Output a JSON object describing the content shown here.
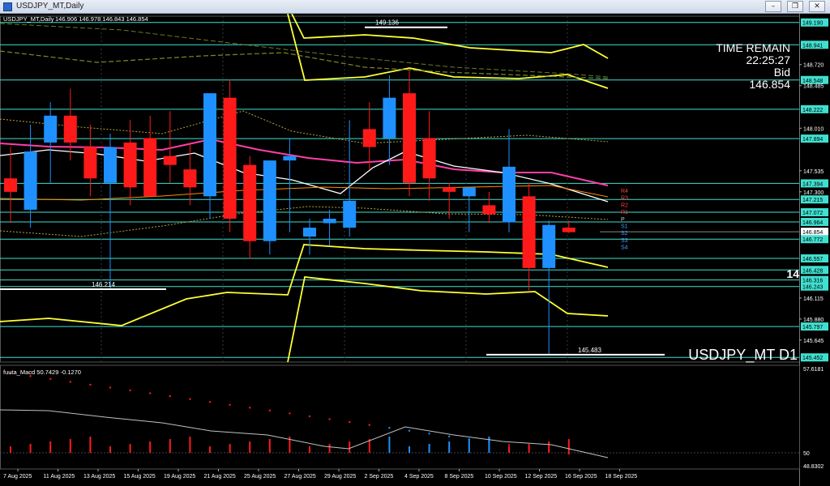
{
  "window": {
    "title": "USDJPY_MT,Daily",
    "buttons": {
      "minimize": "–",
      "restore": "❐",
      "close": "✕"
    }
  },
  "colors": {
    "background": "#000000",
    "bull": "#1e90ff",
    "bear": "#ff1a1a",
    "level_line": "#40e0d0",
    "band": "#ffff33",
    "macd_line": "#c0c0c0"
  },
  "chart_data": {
    "type": "candlestick",
    "symbol_label": "USDJPY_MT,Daily",
    "ohlc_header": "146.906 146.978 146.843 146.854",
    "watermark": "USDJPY_MT D1",
    "info_panel": [
      "TIME REMAIN",
      "22:25:27",
      "Bid",
      "146.854"
    ],
    "ylim": [
      145.4,
      149.26
    ],
    "dates": [
      "7 Aug 2025",
      "11 Aug 2025",
      "13 Aug 2025",
      "15 Aug 2025",
      "19 Aug 2025",
      "21 Aug 2025",
      "25 Aug 2025",
      "27 Aug 2025",
      "29 Aug 2025",
      "2 Sep 2025",
      "4 Sep 2025",
      "8 Sep 2025",
      "10 Sep 2025",
      "12 Sep 2025",
      "16 Sep 2025",
      "18 Sep 2025"
    ],
    "candles": [
      {
        "o": 147.45,
        "h": 147.8,
        "l": 146.95,
        "c": 147.3
      },
      {
        "o": 147.1,
        "h": 148.05,
        "l": 146.9,
        "c": 147.75
      },
      {
        "o": 147.85,
        "h": 148.3,
        "l": 147.4,
        "c": 148.15
      },
      {
        "o": 148.15,
        "h": 148.45,
        "l": 147.65,
        "c": 147.85
      },
      {
        "o": 147.8,
        "h": 148.05,
        "l": 147.25,
        "c": 147.45
      },
      {
        "o": 147.4,
        "h": 147.95,
        "l": 146.21,
        "c": 147.8
      },
      {
        "o": 147.85,
        "h": 148.1,
        "l": 147.15,
        "c": 147.35
      },
      {
        "o": 147.9,
        "h": 148.15,
        "l": 147.3,
        "c": 147.25
      },
      {
        "o": 147.7,
        "h": 148.2,
        "l": 147.4,
        "c": 147.6
      },
      {
        "o": 147.55,
        "h": 147.85,
        "l": 147.15,
        "c": 147.35
      },
      {
        "o": 147.25,
        "h": 148.4,
        "l": 147.0,
        "c": 148.4
      },
      {
        "o": 148.35,
        "h": 148.55,
        "l": 146.85,
        "c": 147.0
      },
      {
        "o": 147.6,
        "h": 147.7,
        "l": 146.55,
        "c": 146.75
      },
      {
        "o": 146.75,
        "h": 147.6,
        "l": 146.6,
        "c": 147.65
      },
      {
        "o": 147.65,
        "h": 147.9,
        "l": 146.85,
        "c": 147.7
      },
      {
        "o": 146.8,
        "h": 147.0,
        "l": 146.6,
        "c": 146.9
      },
      {
        "o": 146.95,
        "h": 147.1,
        "l": 146.7,
        "c": 147.0
      },
      {
        "o": 146.9,
        "h": 148.1,
        "l": 146.8,
        "c": 147.2
      },
      {
        "o": 148.0,
        "h": 148.3,
        "l": 147.55,
        "c": 147.8
      },
      {
        "o": 147.9,
        "h": 148.6,
        "l": 147.6,
        "c": 148.35
      },
      {
        "o": 148.4,
        "h": 148.65,
        "l": 147.25,
        "c": 147.4
      },
      {
        "o": 147.9,
        "h": 148.2,
        "l": 147.2,
        "c": 147.45
      },
      {
        "o": 147.35,
        "h": 147.4,
        "l": 147.0,
        "c": 147.3
      },
      {
        "o": 147.25,
        "h": 147.3,
        "l": 146.85,
        "c": 147.35
      },
      {
        "o": 147.15,
        "h": 147.3,
        "l": 146.95,
        "c": 147.05
      },
      {
        "o": 146.96,
        "h": 148.0,
        "l": 146.85,
        "c": 147.58
      },
      {
        "o": 147.25,
        "h": 147.4,
        "l": 146.2,
        "c": 146.45
      },
      {
        "o": 146.45,
        "h": 146.98,
        "l": 145.48,
        "c": 146.93
      },
      {
        "o": 146.9,
        "h": 146.98,
        "l": 146.84,
        "c": 146.85
      }
    ],
    "price_levels": [
      {
        "label": "149.190",
        "value": 149.19
      },
      {
        "label": "148.941",
        "value": 148.941
      },
      {
        "label": "148.548",
        "value": 148.548
      },
      {
        "label": "148.222",
        "value": 148.222
      },
      {
        "label": "147.894",
        "value": 147.894
      },
      {
        "label": "147.394",
        "value": 147.394
      },
      {
        "label": "147.215",
        "value": 147.215
      },
      {
        "label": "147.072",
        "value": 147.072
      },
      {
        "label": "146.964",
        "value": 146.964
      },
      {
        "label": "146.772",
        "value": 146.772
      },
      {
        "label": "146.557",
        "value": 146.557
      },
      {
        "label": "146.428",
        "value": 146.428
      },
      {
        "label": "146.316",
        "value": 146.316
      },
      {
        "label": "146.243",
        "value": 146.243
      },
      {
        "label": "145.797",
        "value": 145.797
      },
      {
        "label": "145.452",
        "value": 145.452
      }
    ],
    "axis_ticks": [
      {
        "label": "149.190",
        "value": 149.19,
        "hl": true
      },
      {
        "label": "148.941",
        "value": 148.941,
        "hl": true
      },
      {
        "label": "148.720",
        "value": 148.72,
        "hl": false
      },
      {
        "label": "148.548",
        "value": 148.548,
        "hl": true
      },
      {
        "label": "148.485",
        "value": 148.485,
        "hl": false
      },
      {
        "label": "148.222",
        "value": 148.222,
        "hl": true
      },
      {
        "label": "148.010",
        "value": 148.01,
        "hl": false
      },
      {
        "label": "147.894",
        "value": 147.894,
        "hl": true
      },
      {
        "label": "147.535",
        "value": 147.535,
        "hl": false
      },
      {
        "label": "147.394",
        "value": 147.394,
        "hl": true
      },
      {
        "label": "147.300",
        "value": 147.3,
        "hl": false
      },
      {
        "label": "147.215",
        "value": 147.215,
        "hl": true
      },
      {
        "label": "147.072",
        "value": 147.072,
        "hl": true
      },
      {
        "label": "146.964",
        "value": 146.964,
        "hl": true
      },
      {
        "label": "146.854",
        "value": 146.854,
        "hl": "bid"
      },
      {
        "label": "146.772",
        "value": 146.772,
        "hl": true
      },
      {
        "label": "146.557",
        "value": 146.557,
        "hl": true
      },
      {
        "label": "146.428",
        "value": 146.428,
        "hl": true
      },
      {
        "label": "146.316",
        "value": 146.316,
        "hl": true
      },
      {
        "label": "146.243",
        "value": 146.243,
        "hl": true
      },
      {
        "label": "146.115",
        "value": 146.115,
        "hl": false
      },
      {
        "label": "145.880",
        "value": 145.88,
        "hl": false
      },
      {
        "label": "145.797",
        "value": 145.797,
        "hl": true
      },
      {
        "label": "145.645",
        "value": 145.645,
        "hl": false
      },
      {
        "label": "145.452",
        "value": 145.452,
        "hl": true
      }
    ],
    "pivot_labels": [
      "R4",
      "R3",
      "R2",
      "R1",
      "P",
      "S1",
      "S2",
      "S3",
      "S4"
    ],
    "markers": [
      {
        "label": "149.136",
        "value": 149.136
      },
      {
        "label": "146.214",
        "value": 146.214
      },
      {
        "label": "145.483",
        "value": 145.483
      }
    ],
    "partial_label": "14",
    "macd": {
      "label": "fuuta_Macd 50.7429 -0.1270",
      "ylim": [
        48.8302,
        57.6181
      ],
      "ticks": [
        "57.6181",
        "50",
        "48.8302"
      ]
    }
  }
}
